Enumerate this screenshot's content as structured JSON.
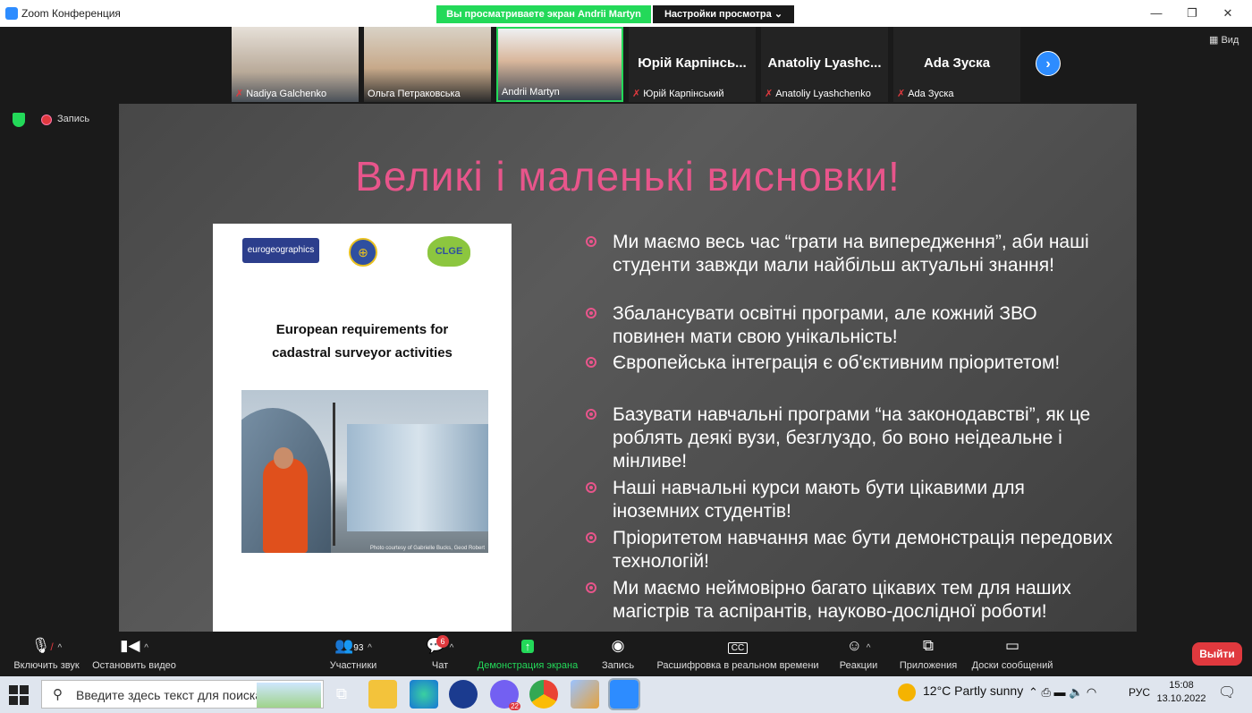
{
  "window": {
    "title": "Zoom Конференция",
    "view_banner": "Вы просматриваете экран Andrii Martyn",
    "view_settings": "Настройки просмотра ⌄",
    "minimize": "—",
    "restore": "❐",
    "close": "✕"
  },
  "gallery": {
    "tiles": [
      {
        "name": "Nadiya Galchenko",
        "muted": true,
        "video": true
      },
      {
        "name": "Ольга Петраковська",
        "muted": false,
        "video": true
      },
      {
        "name": "Andrii Martyn",
        "muted": false,
        "video": true
      },
      {
        "big_name": "Юрій Карпінсь...",
        "name": "Юрій Карпінський",
        "muted": true,
        "video": false
      },
      {
        "big_name": "Anatoliy Lyashc...",
        "name": "Anatoliy Lyashchenko",
        "muted": true,
        "video": false
      },
      {
        "big_name": "Ada Зуска",
        "name": "Ada Зуска",
        "muted": true,
        "video": false
      }
    ],
    "next": "›",
    "view_button": "▦ Вид"
  },
  "recording": {
    "label": "Запись"
  },
  "slide": {
    "title": "Великі і маленькі висновки!",
    "document": {
      "logo1": "eurogeographics",
      "title_line1": "European requirements for",
      "title_line2": "cadastral surveyor activities",
      "photo_credit": "Photo courtesy of Gabrielle Bucks, Geod Robert"
    },
    "bullets": [
      "Ми маємо весь час “грати на випередження”, аби наші студенти завжди мали найбільш актуальні знання!",
      "Збалансувати освітні програми, але кожний ЗВО повинен мати свою унікальність!",
      "Європейська інтеграція є об'єктивним пріоритетом!",
      "Базувати навчальні програми “на законодавстві”, як це роблять деякі вузи, безглуздо, бо воно неідеальне і мінливе!",
      "Наші навчальні курси мають бути цікавими для іноземних студентів!",
      "Пріоритетом навчання має бути демонстрація передових технологій!",
      "Ми маємо неймовірно багато цікавих тем для наших магістрів та аспірантів, науково-дослідної роботи!"
    ]
  },
  "toolbar": {
    "unmute": "Включить звук",
    "start_video": "Остановить видео",
    "participants": "Участники",
    "participants_count": "93",
    "chat": "Чат",
    "chat_badge": "6",
    "share": "Демонстрация экрана",
    "record": "Запись",
    "transcription": "Расшифровка в реальном времени",
    "reactions": "Реакции",
    "apps": "Приложения",
    "whiteboards": "Доски сообщений",
    "leave": "Выйти"
  },
  "taskbar": {
    "search_placeholder": "Введите здесь текст для поиска",
    "weather": "12°C  Partly sunny",
    "lang": "РУС",
    "time": "15:08",
    "date": "13.10.2022",
    "viber_badge": "22"
  },
  "colors": {
    "accent_pink": "#e8558b",
    "zoom_blue": "#2d8cff",
    "share_green": "#23d959",
    "leave_red": "#e0393e"
  }
}
